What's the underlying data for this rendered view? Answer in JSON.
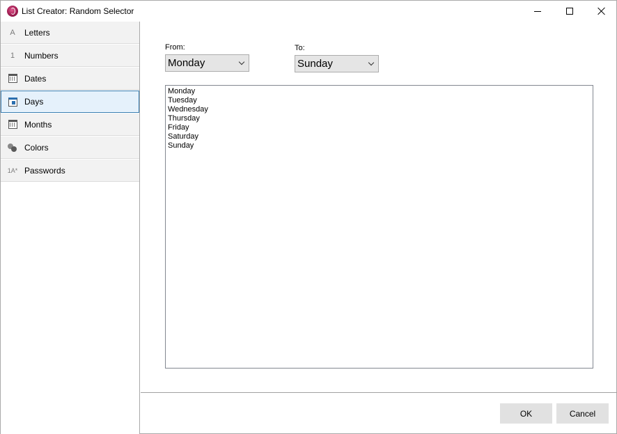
{
  "window": {
    "title": "List Creator: Random Selector"
  },
  "sidebar": {
    "items": [
      {
        "icon": "letter-a-icon",
        "glyph": "A",
        "label": "Letters"
      },
      {
        "icon": "number-one-icon",
        "glyph": "1",
        "label": "Numbers"
      },
      {
        "icon": "calendar-icon",
        "glyph": "",
        "label": "Dates"
      },
      {
        "icon": "calendar-day-icon",
        "glyph": "",
        "label": "Days",
        "selected": true
      },
      {
        "icon": "calendar-icon",
        "glyph": "",
        "label": "Months"
      },
      {
        "icon": "color-dots-icon",
        "glyph": "",
        "label": "Colors"
      },
      {
        "icon": "password-icon",
        "glyph": "1A*",
        "label": "Passwords"
      }
    ]
  },
  "main": {
    "from_label": "From:",
    "from_value": "Monday",
    "to_label": "To:",
    "to_value": "Sunday",
    "list": [
      "Monday",
      "Tuesday",
      "Wednesday",
      "Thursday",
      "Friday",
      "Saturday",
      "Sunday"
    ]
  },
  "footer": {
    "ok_label": "OK",
    "cancel_label": "Cancel"
  }
}
